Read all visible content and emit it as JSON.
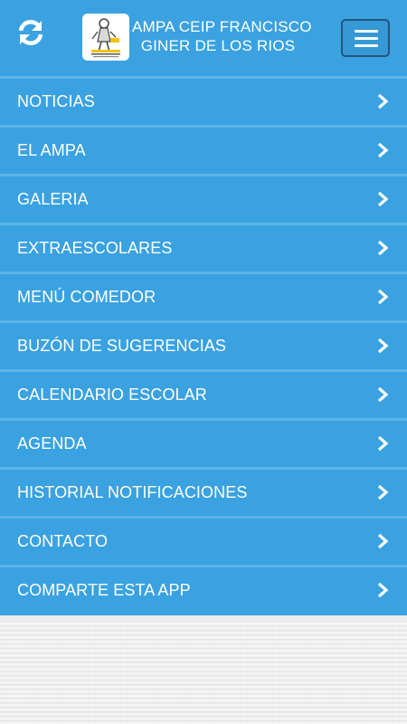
{
  "header": {
    "title_line1": "AMPA CEIP FRANCISCO",
    "title_line2": "GINER DE LOS RIOS",
    "refresh_icon": "refresh-icon",
    "menu_icon": "hamburger-icon"
  },
  "menu": {
    "items": [
      {
        "label": "NOTICIAS"
      },
      {
        "label": "EL AMPA"
      },
      {
        "label": "GALERIA"
      },
      {
        "label": "EXTRAESCOLARES"
      },
      {
        "label": "MENÚ COMEDOR"
      },
      {
        "label": "BUZÓN DE SUGERENCIAS"
      },
      {
        "label": "CALENDARIO ESCOLAR"
      },
      {
        "label": "AGENDA"
      },
      {
        "label": "HISTORIAL NOTIFICACIONES"
      },
      {
        "label": "CONTACTO"
      },
      {
        "label": "COMPARTE ESTA APP"
      }
    ]
  },
  "colors": {
    "primary": "#3aa2e0",
    "divider": "#5db4e8",
    "text": "#ffffff",
    "background": "#ececec"
  }
}
